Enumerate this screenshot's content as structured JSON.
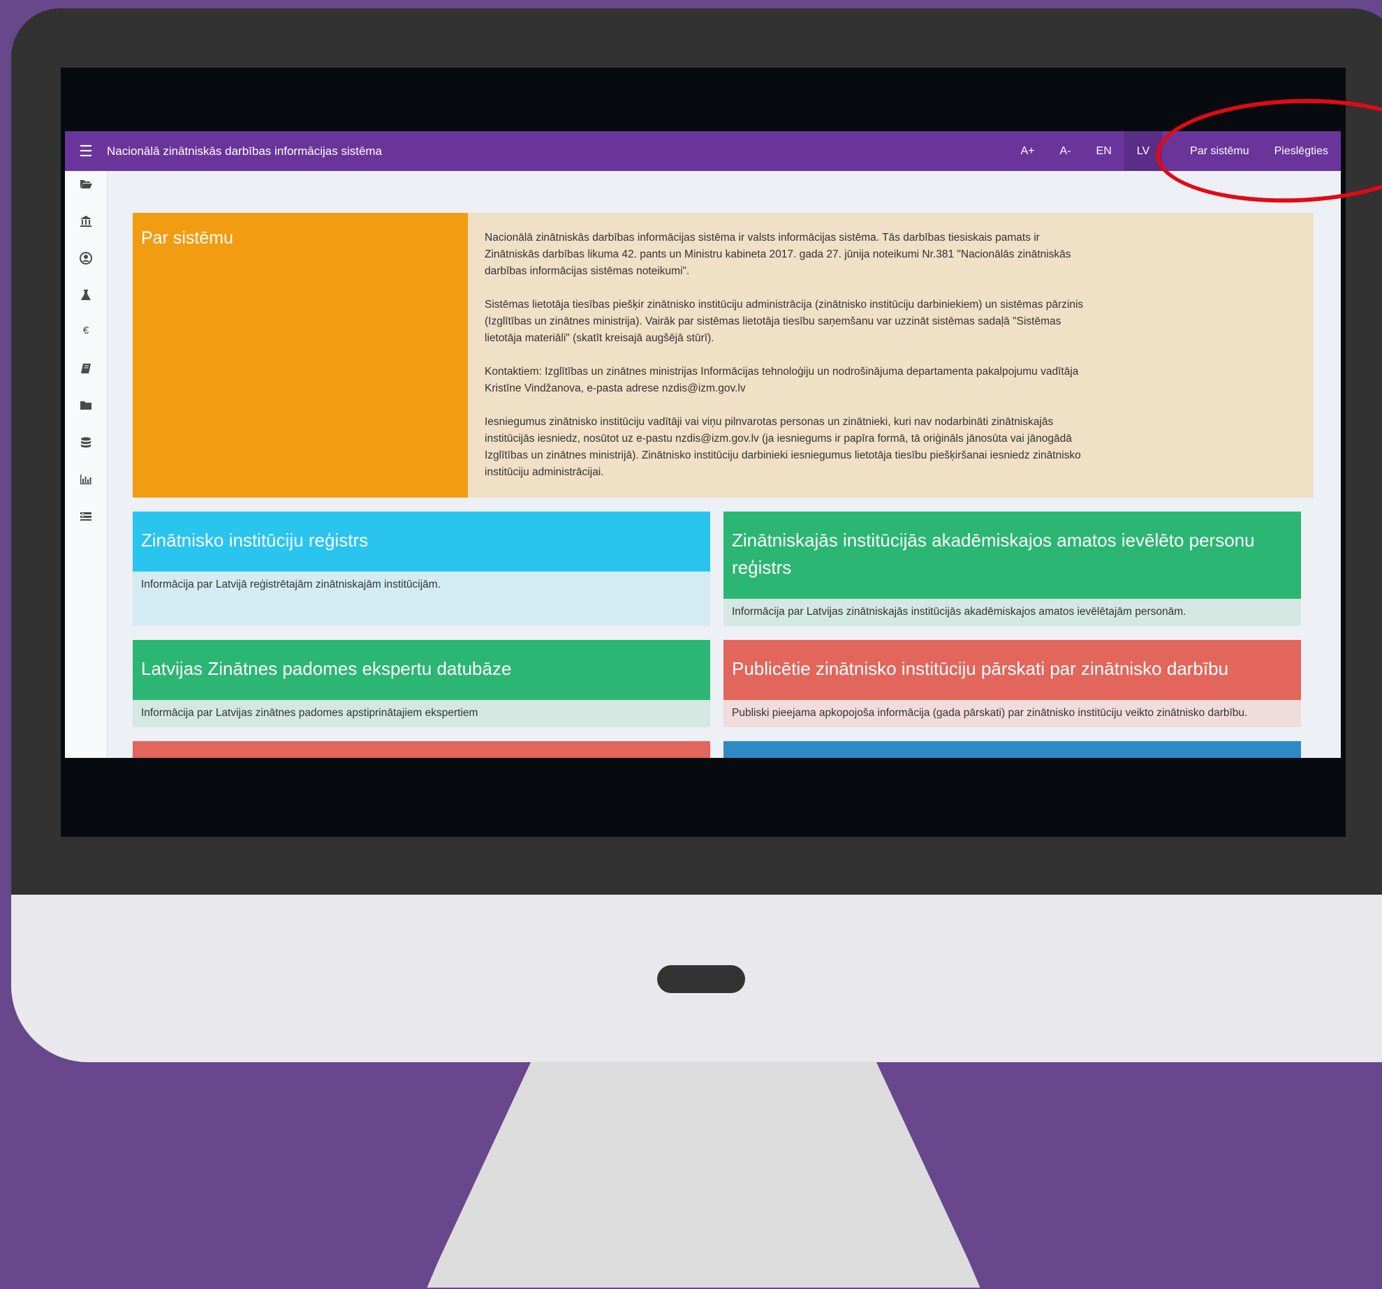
{
  "header": {
    "title": "Nacionālā zinātniskās darbības informācijas sistēma",
    "actions": [
      "A+",
      "A-",
      "EN",
      "LV"
    ],
    "about_link": "Par sistēmu",
    "login_link": "Pieslēgties"
  },
  "about": {
    "title": "Par sistēmu",
    "paragraphs": [
      "Nacionālā zinātniskās darbības informācijas sistēma ir valsts informācijas sistēma. Tās darbības tiesiskais pamats ir Zinātniskās darbības likuma 42. pants un Ministru kabineta 2017. gada 27. jūnija noteikumi Nr.381 \"Nacionālās zinātniskās darbības informācijas sistēmas noteikumi\".",
      "Sistēmas lietotāja tiesības piešķir zinātnisko institūciju administrācija (zinātnisko institūciju darbiniekiem) un sistēmas pārzinis (Izglītības un zinātnes ministrija). Vairāk par sistēmas lietotāja tiesību saņemšanu var uzzināt sistēmas sadaļā \"Sistēmas lietotāja materiāli\" (skatīt kreisajā augšējā stūrī).",
      "Kontaktiem: Izglītības un zinātnes ministrijas Informācijas tehnoloģiju un nodrošinājuma departamenta pakalpojumu vadītāja Kristīne Vindžanova, e-pasta adrese nzdis@izm.gov.lv",
      "Iesniegumus zinātnisko institūciju vadītāji vai viņu pilnvarotas personas un zinātnieki, kuri nav nodarbināti zinātniskajās institūcijās iesniedz, nosūtot uz e-pastu nzdis@izm.gov.lv (ja iesniegums ir papīra formā, tā oriģināls jānosūta vai jānogādā Izglītības un zinātnes ministrijā). Zinātnisko institūciju darbinieki iesniegumus lietotāja tiesību piešķiršanai iesniedz zinātnisko institūciju administrācijai."
    ]
  },
  "cards": [
    {
      "title": "Zinātnisko institūciju reģistrs",
      "description": "Informācija par Latvijā reģistrētajām zinātniskajām institūcijām.",
      "head_color": "#29c5ef",
      "body_color": "#d3ebf3"
    },
    {
      "title": "Zinātniskajās institūcijās akadēmiskajos amatos ievēlēto personu reģistrs",
      "description": "Informācija par Latvijas zinātniskajās institūcijās akadēmiskajos amatos ievēlētajām personām.",
      "head_color": "#2bb673",
      "body_color": "#d3e8e1"
    },
    {
      "title": "Latvijas Zinātnes padomes ekspertu datubāze",
      "description": "Informācija par Latvijas zinātnes padomes apstiprinātajiem ekspertiem",
      "head_color": "#2bb673",
      "body_color": "#d3e8e1"
    },
    {
      "title": "Publicētie zinātnisko institūciju pārskati par zinātnisko darbību",
      "description": "Publiski pieejama apkopojoša informācija (gada pārskati) par zinātnisko institūciju veikto zinātnisko darbību.",
      "head_color": "#e2665b",
      "body_color": "#f1dcdc"
    },
    {
      "title": "",
      "description": "",
      "head_color": "#e2665b",
      "body_color": "#f1dcdc"
    },
    {
      "title": "",
      "description": "",
      "head_color": "#2d8ac4",
      "body_color": "#d3e4ef"
    }
  ],
  "sidebar_icons": [
    "folder-open-icon",
    "institution-icon",
    "user-circle-icon",
    "flask-icon",
    "euro-icon",
    "book-icon",
    "folder-icon",
    "database-icon",
    "bar-chart-icon",
    "list-icon"
  ],
  "annotation_color": "#e10a14"
}
